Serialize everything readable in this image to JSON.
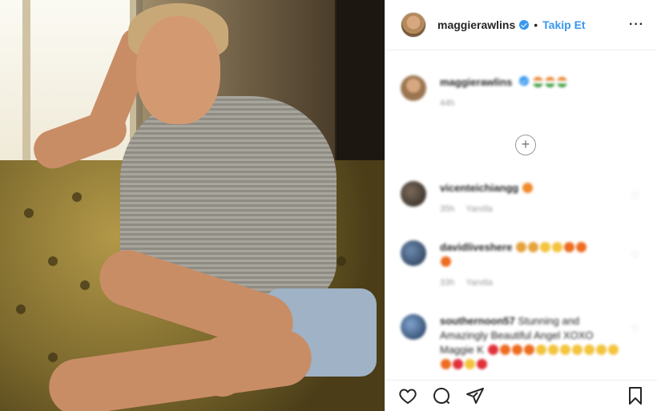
{
  "header": {
    "username": "maggierawlins",
    "separator": "•",
    "follow_label": "Takip Et",
    "more_label": "···"
  },
  "caption": {
    "username": "maggierawlins",
    "time": "44h"
  },
  "load_more_icon": "plus-circle-icon",
  "comments": [
    {
      "username": "vicenteichiangg",
      "time": "35h",
      "reply_label": "Yanıtla"
    },
    {
      "username": "davidliveshere",
      "time": "33h",
      "reply_label": "Yanıtla"
    },
    {
      "username": "southernoon57",
      "text": "Stunning and Amazingly Beautiful Angel XOXO Maggie K"
    }
  ],
  "action_icons": [
    "heart-icon",
    "comment-icon",
    "share-icon",
    "bookmark-icon"
  ],
  "colors": {
    "link": "#3897f0",
    "text": "#262626",
    "muted": "#999999"
  }
}
